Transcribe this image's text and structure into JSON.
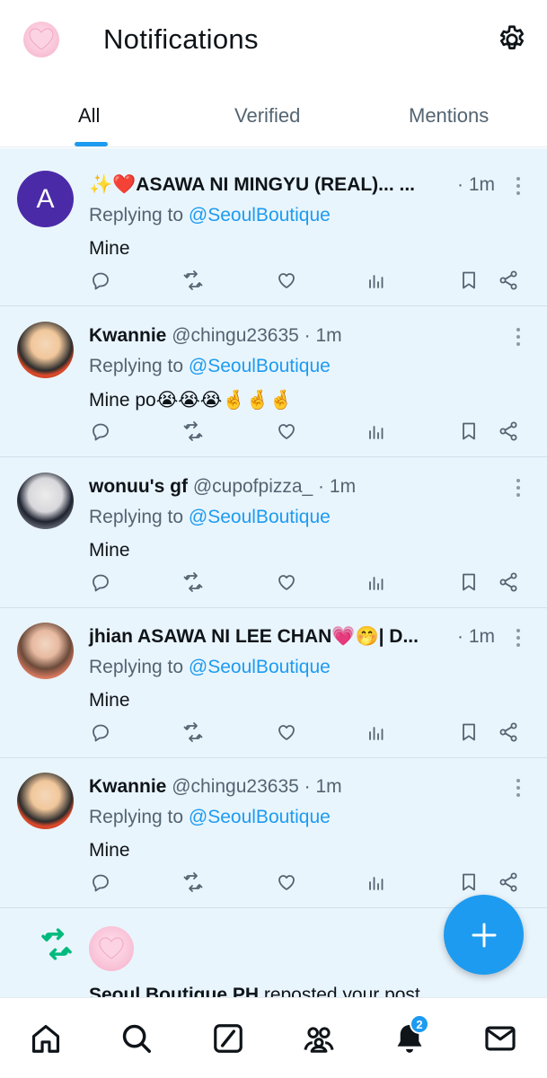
{
  "header": {
    "title": "Notifications"
  },
  "tabs": [
    {
      "label": "All",
      "active": true
    },
    {
      "label": "Verified",
      "active": false
    },
    {
      "label": "Mentions",
      "active": false
    }
  ],
  "colors": {
    "accent": "#1d9bf0",
    "feed_bg": "#e9f5fd",
    "repost_green": "#00ba7c"
  },
  "notifications": [
    {
      "avatar_letter": "A",
      "name": "✨❤️ASAWA NI MINGYU (REAL)... ...",
      "handle": "",
      "time": "· 1m",
      "reply_prefix": "Replying to ",
      "reply_to": "@SeoulBoutique",
      "text": "Mine"
    },
    {
      "name": "Kwannie",
      "handle": "@chingu23635 · 1m",
      "time": "",
      "reply_prefix": "Replying to ",
      "reply_to": "@SeoulBoutique",
      "text": "Mine po😭😭😭🤞🤞🤞"
    },
    {
      "name": "wonuu's gf",
      "handle": "@cupofpizza_ · 1m",
      "time": "",
      "reply_prefix": "Replying to ",
      "reply_to": "@SeoulBoutique",
      "text": "Mine"
    },
    {
      "name": "jhian ASAWA NI LEE CHAN💗🤭| D...",
      "handle": "",
      "time": "· 1m",
      "reply_prefix": "Replying to ",
      "reply_to": "@SeoulBoutique",
      "text": "Mine"
    },
    {
      "name": "Kwannie",
      "handle": "@chingu23635 · 1m",
      "time": "",
      "reply_prefix": "Replying to ",
      "reply_to": "@SeoulBoutique",
      "text": "Mine"
    }
  ],
  "repost": {
    "name": "Seoul Boutique PH",
    "text": " reposted your post"
  },
  "bottom_nav": {
    "notification_badge": "2"
  },
  "icons": {
    "header": [
      "profile-avatar",
      "gear-icon"
    ],
    "actions": [
      "reply-icon",
      "retweet-icon",
      "like-icon",
      "views-icon",
      "bookmark-icon",
      "share-icon"
    ],
    "nav": [
      "home-icon",
      "search-icon",
      "grok-icon",
      "communities-icon",
      "bell-icon",
      "mail-icon"
    ]
  }
}
